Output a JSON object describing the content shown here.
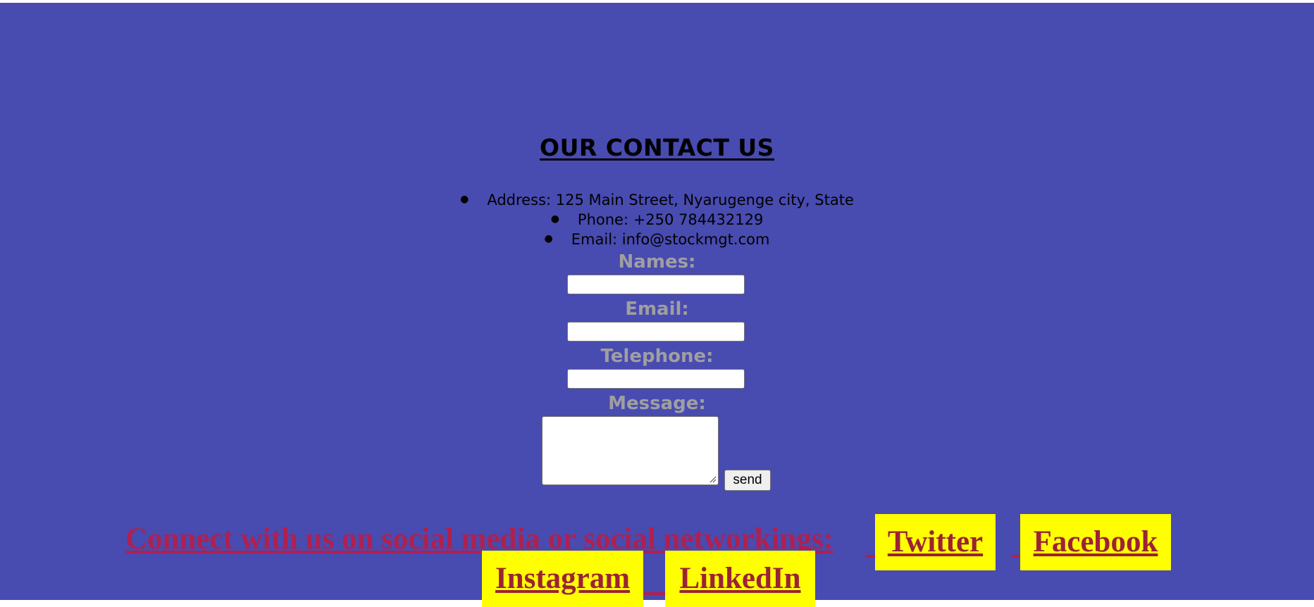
{
  "contact": {
    "title": "OUR CONTACT US",
    "address": "Address: 125 Main Street, Nyarugenge city, State",
    "phone": "Phone: +250 784432129",
    "email": "Email: info@stockmgt.com"
  },
  "form": {
    "names_label": "Names:",
    "email_label": "Email:",
    "telephone_label": "Telephone:",
    "message_label": "Message:",
    "names_value": "",
    "email_value": "",
    "telephone_value": "",
    "message_value": "",
    "send_label": "send"
  },
  "social": {
    "heading": "Connect with us on social media or social networkings:",
    "links": [
      {
        "label": "Twitter"
      },
      {
        "label": "Facebook"
      },
      {
        "label": "Instagram"
      },
      {
        "label": "LinkedIn"
      }
    ]
  },
  "colors": {
    "background": "#484bb0",
    "label": "#9f9fa0",
    "social_heading": "#b0204f",
    "link_text": "#9b2335",
    "link_background": "#ffff00"
  }
}
